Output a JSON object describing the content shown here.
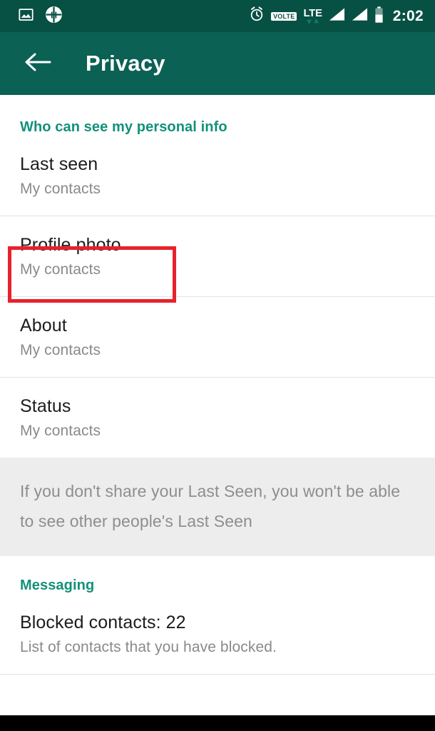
{
  "status_bar": {
    "left_icons": [
      "image-icon",
      "hike-badge-icon"
    ],
    "right_icons": [
      "alarm-icon",
      "volte-icon",
      "lte-icon",
      "signal-1-icon",
      "signal-2-icon",
      "battery-icon"
    ],
    "volte_label": "VOLTE",
    "lte_label": "LTE",
    "time": "2:02",
    "background_color": "#075044"
  },
  "app_bar": {
    "back_icon": "arrow-left-icon",
    "title": "Privacy",
    "background_color": "#0b6153"
  },
  "sections": {
    "personal_info": {
      "header": "Who can see my personal info",
      "header_color": "#12917a",
      "items": [
        {
          "title": "Last seen",
          "value": "My contacts"
        },
        {
          "title": "Profile photo",
          "value": "My contacts"
        },
        {
          "title": "About",
          "value": "My contacts"
        },
        {
          "title": "Status",
          "value": "My contacts"
        }
      ],
      "info_note": "If you don't share your Last Seen, you won't be able to see other people's Last Seen"
    },
    "messaging": {
      "header": "Messaging",
      "header_color": "#12917a",
      "items": [
        {
          "title": "Blocked contacts: 22",
          "value": "List of contacts that you have blocked."
        }
      ]
    }
  },
  "annotation": {
    "target": "Profile photo",
    "color": "#e8212b"
  }
}
